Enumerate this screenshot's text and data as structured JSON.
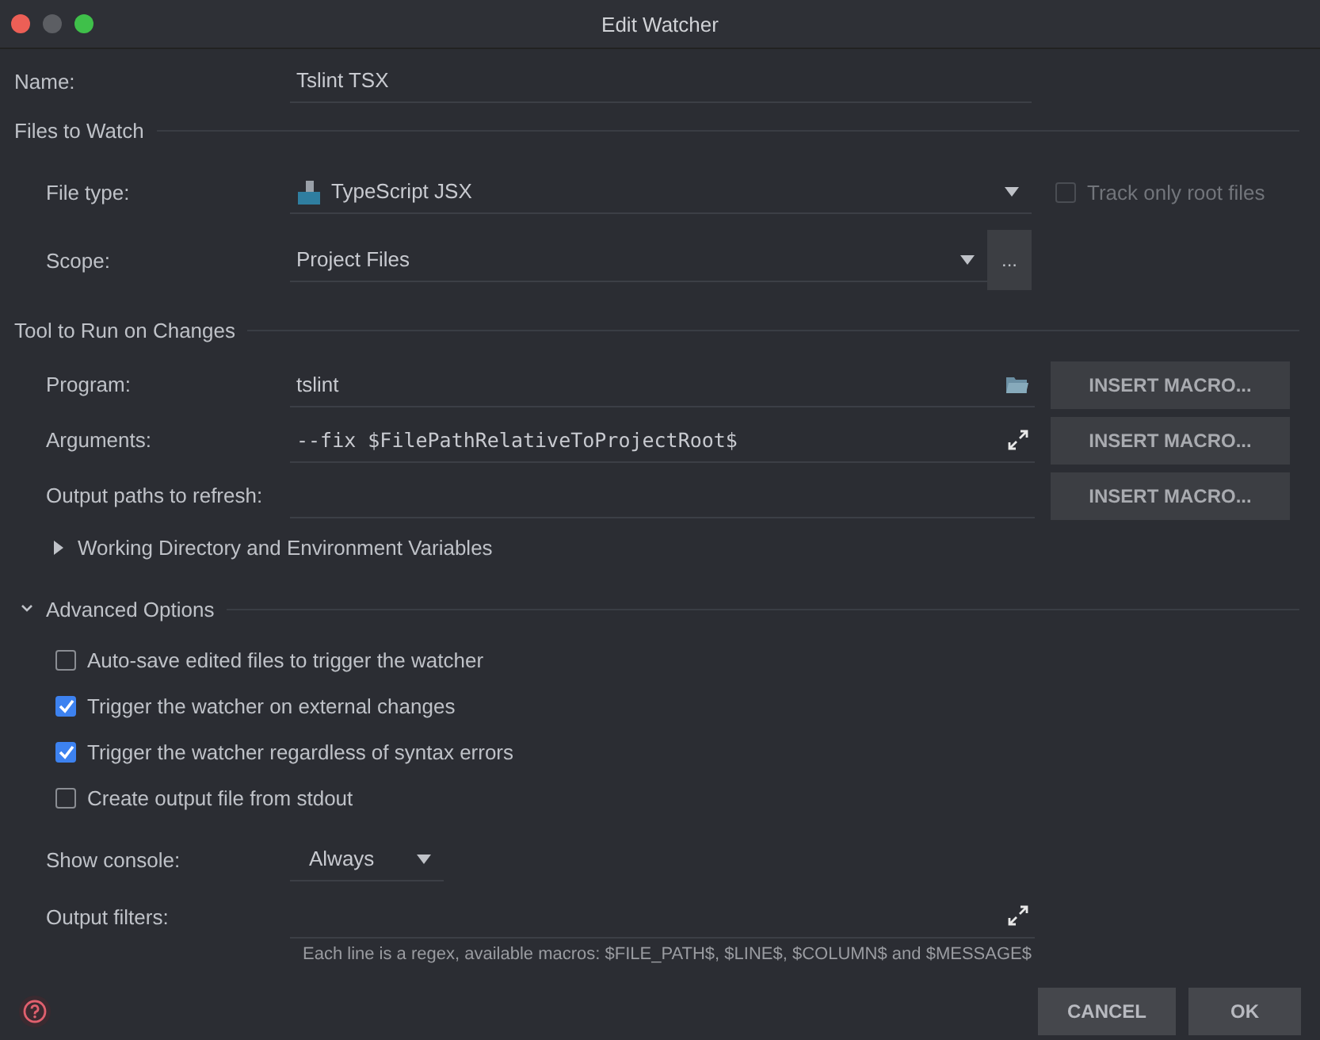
{
  "window": {
    "title": "Edit Watcher"
  },
  "name": {
    "label": "Name:",
    "value": "Tslint TSX"
  },
  "files_to_watch": {
    "title": "Files to Watch",
    "file_type": {
      "label": "File type:",
      "value": "TypeScript JSX"
    },
    "track_only_root_files": {
      "label": "Track only root files",
      "checked": false,
      "disabled": true
    },
    "scope": {
      "label": "Scope:",
      "value": "Project Files",
      "browse": "..."
    }
  },
  "tool": {
    "title": "Tool to Run on Changes",
    "fields": [
      {
        "label": "Program:",
        "value": "tslint",
        "kind": "folder",
        "button": "INSERT MACRO..."
      },
      {
        "label": "Arguments:",
        "value": "--fix $FilePathRelativeToProjectRoot$",
        "kind": "expand",
        "button": "INSERT MACRO..."
      },
      {
        "label": "Output paths to refresh:",
        "kind": "plain",
        "button": "INSERT MACRO..."
      }
    ],
    "working_directory": {
      "label": "Working Directory and Environment Variables",
      "expanded": false
    }
  },
  "advanced": {
    "title": "Advanced Options",
    "expanded": true,
    "options": [
      {
        "label": "Auto-save edited files to trigger the watcher",
        "checked": false
      },
      {
        "label": "Trigger the watcher on external changes",
        "checked": true
      },
      {
        "label": "Trigger the watcher regardless of syntax errors",
        "checked": true
      },
      {
        "label": "Create output file from stdout",
        "checked": false
      }
    ],
    "show_console": {
      "label": "Show console:",
      "value": "Always"
    },
    "output_filters": {
      "label": "Output filters:",
      "hint": "Each line is a regex, available macros: $FILE_PATH$, $LINE$, $COLUMN$ and $MESSAGE$"
    }
  },
  "buttons": [
    "CANCEL",
    "OK"
  ]
}
